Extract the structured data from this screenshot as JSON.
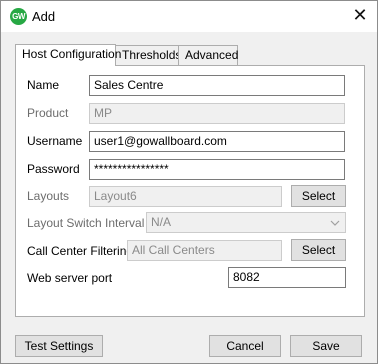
{
  "window": {
    "title": "Add",
    "icon_text": "GW",
    "close_glyph": "✕"
  },
  "tabs": [
    {
      "label": "Host Configuration",
      "active": true
    },
    {
      "label": "Thresholds",
      "active": false
    },
    {
      "label": "Advanced",
      "active": false
    }
  ],
  "form": {
    "name": {
      "label": "Name",
      "value": "Sales Centre"
    },
    "product": {
      "label": "Product",
      "value": "MP"
    },
    "username": {
      "label": "Username",
      "value": "user1@gowallboard.com"
    },
    "password": {
      "label": "Password",
      "value": "****************"
    },
    "layouts": {
      "label": "Layouts",
      "value": "Layout6",
      "button": "Select"
    },
    "layout_switch_interval": {
      "label": "Layout Switch Interval",
      "value": "N/A"
    },
    "call_center_filtering": {
      "label": "Call Center Filtering",
      "value": "All Call Centers",
      "button": "Select"
    },
    "web_server_port": {
      "label": "Web server port",
      "value": "8082"
    }
  },
  "footer": {
    "test_settings": "Test Settings",
    "cancel": "Cancel",
    "save": "Save"
  },
  "icons": {
    "app": "gowallboard-logo-icon",
    "close": "close-icon",
    "dropdown": "chevron-down-icon"
  },
  "colors": {
    "app_icon": "#27a844",
    "dialog_bg": "#f0f0f0",
    "button_bg": "#e1e1e1"
  }
}
